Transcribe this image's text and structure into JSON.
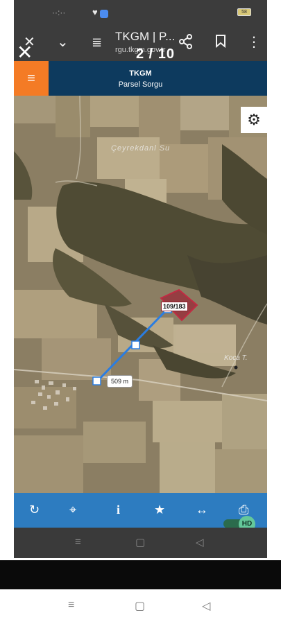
{
  "status_bar": {
    "time": "··:··",
    "notification_icon": "♥",
    "battery_icon": "battery-icon",
    "battery_level": "58"
  },
  "browser": {
    "close_icon": "✕",
    "dropdown_icon": "⌄",
    "settings_icon": "≣",
    "title": "TKGM | P...",
    "url": "rgu.tkgm.gov.tr",
    "share_icon": "share-icon",
    "bookmark_icon": "bookmark-icon",
    "more_icon": "⋮"
  },
  "viewer": {
    "counter": "2 / 10",
    "close_icon": "✕"
  },
  "app": {
    "menu_icon": "≡",
    "title": "TKGM",
    "subtitle": "Parsel Sorgu",
    "accent_color": "#f47b25",
    "header_color": "#0d3a5e"
  },
  "map": {
    "settings_icon": "⚙",
    "place_label_1": "Çeyrekdanl Su",
    "place_label_2": "Koca T.",
    "parcel_label": "109/183",
    "parcel_color": "#9b1c31",
    "measure_distance": "509 m",
    "measure_color": "#2a7de1"
  },
  "toolbar": {
    "color": "#2d7cc0",
    "refresh_icon": "↻",
    "locate_icon": "⌖",
    "info_icon": "i",
    "favorite_icon": "★",
    "measure_icon": "↔",
    "print_icon": "⎙"
  },
  "hd_toggle": {
    "label": "HD",
    "on": true
  },
  "inner_nav": {
    "recents": "≡",
    "home": "▢",
    "back": "◁"
  },
  "system_nav": {
    "recents": "≡",
    "home": "▢",
    "back": "◁"
  }
}
